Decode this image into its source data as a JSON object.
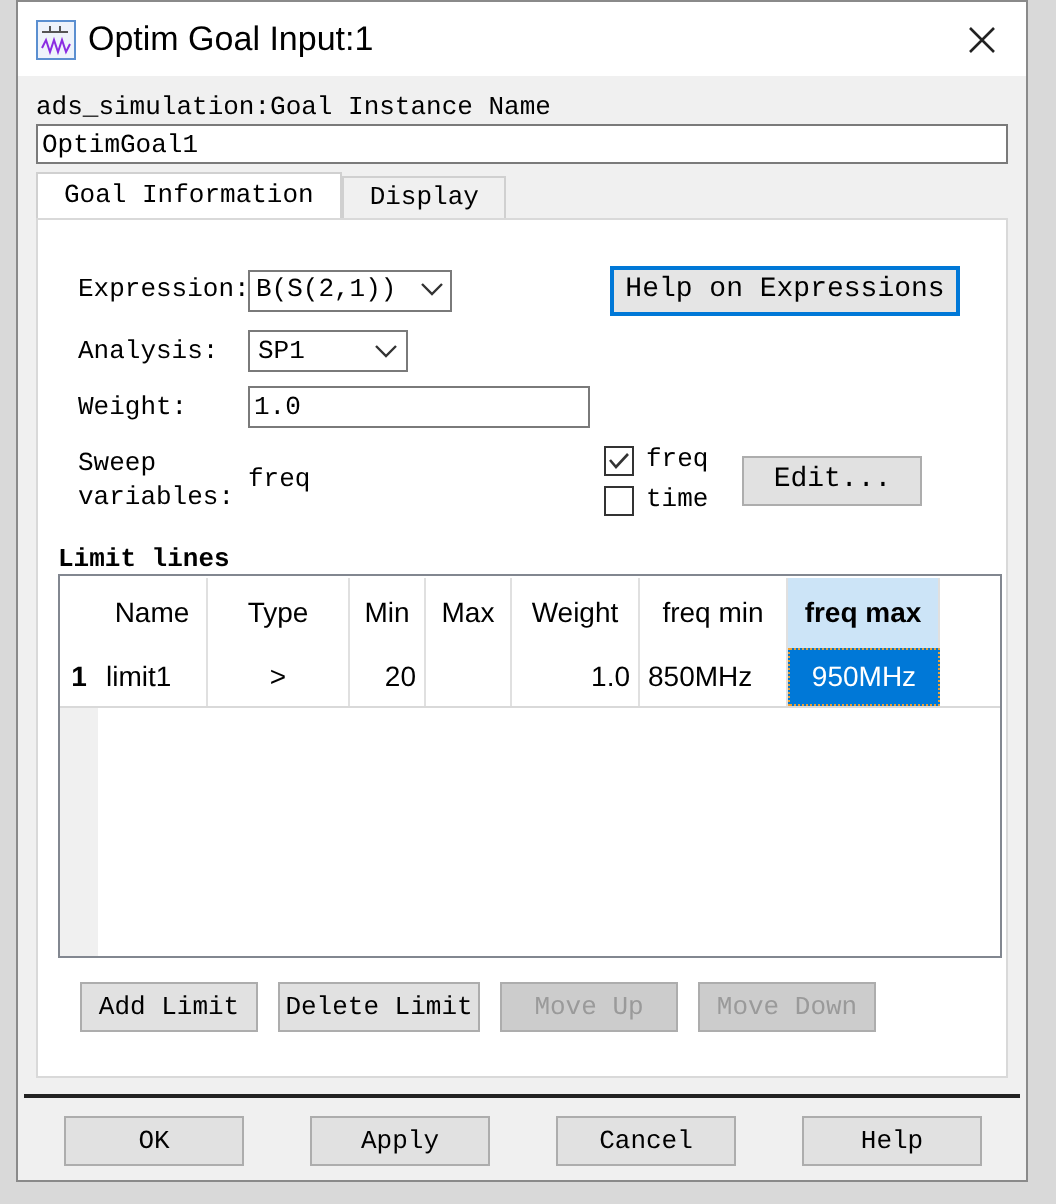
{
  "window": {
    "title": "Optim Goal Input:1"
  },
  "instance_name": {
    "label": "ads_simulation:Goal Instance Name",
    "value": "OptimGoal1"
  },
  "tabs": [
    {
      "label": "Goal Information",
      "selected": true
    },
    {
      "label": "Display",
      "selected": false
    }
  ],
  "form": {
    "expression": {
      "label": "Expression:",
      "value": "B(S(2,1))"
    },
    "help_button": "Help on Expressions",
    "analysis": {
      "label": "Analysis:",
      "value": "SP1"
    },
    "weight": {
      "label": "Weight:",
      "value": "1.0"
    },
    "sweep": {
      "label": "Sweep variables:",
      "value": "freq"
    },
    "sweep_options": [
      {
        "label": "freq",
        "checked": true
      },
      {
        "label": "time",
        "checked": false
      }
    ],
    "edit_button": "Edit..."
  },
  "limit_lines": {
    "title": "Limit lines",
    "columns": [
      {
        "label": "Name",
        "selected": false
      },
      {
        "label": "Type",
        "selected": false
      },
      {
        "label": "Min",
        "selected": false
      },
      {
        "label": "Max",
        "selected": false
      },
      {
        "label": "Weight",
        "selected": false
      },
      {
        "label": "freq min",
        "selected": false
      },
      {
        "label": "freq max",
        "selected": true
      }
    ],
    "rows": [
      {
        "number": "1",
        "cells": [
          {
            "text": "limit1",
            "selected": false
          },
          {
            "text": ">",
            "selected": false
          },
          {
            "text": "20",
            "selected": false
          },
          {
            "text": "",
            "selected": false
          },
          {
            "text": "1.0",
            "selected": false
          },
          {
            "text": "850MHz",
            "selected": false
          },
          {
            "text": "950MHz",
            "selected": true
          }
        ]
      }
    ],
    "buttons": [
      {
        "label": "Add Limit",
        "disabled": false
      },
      {
        "label": "Delete Limit",
        "disabled": false
      },
      {
        "label": "Move Up",
        "disabled": true
      },
      {
        "label": "Move Down",
        "disabled": true
      }
    ]
  },
  "dialog_buttons": [
    {
      "label": "OK"
    },
    {
      "label": "Apply"
    },
    {
      "label": "Cancel"
    },
    {
      "label": "Help"
    }
  ]
}
